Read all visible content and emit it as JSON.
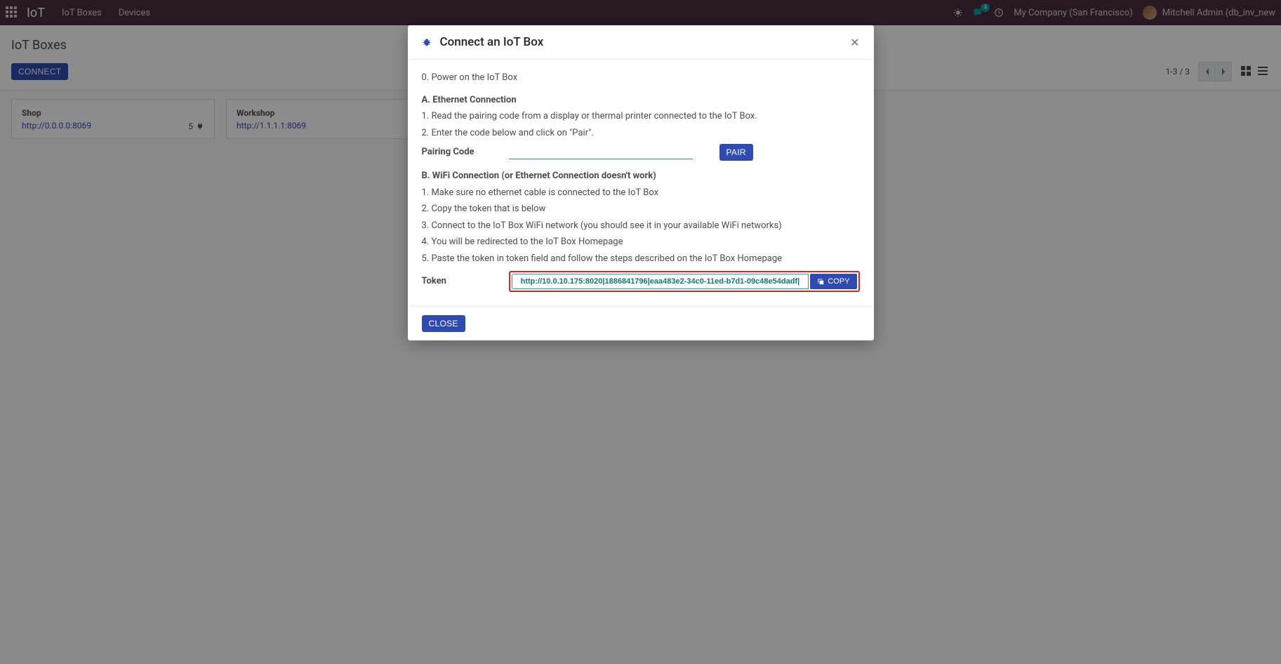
{
  "navbar": {
    "brand": "IoT",
    "links": [
      "IoT Boxes",
      "Devices"
    ],
    "messages_count": "4",
    "company": "My Company (San Francisco)",
    "user": "Mitchell Admin (db_inv_new"
  },
  "control_panel": {
    "breadcrumb": "IoT Boxes",
    "connect_label": "CONNECT",
    "pager": "1-3 / 3"
  },
  "cards": [
    {
      "title": "Shop",
      "url": "http://0.0.0.0:8069",
      "devices": "5"
    },
    {
      "title": "Workshop",
      "url": "http://1.1.1.1:8069",
      "devices": ""
    }
  ],
  "modal": {
    "title": "Connect an IoT Box",
    "step0": "0. Power on the IoT Box",
    "section_a_head": "A. Ethernet Connection",
    "section_a_1": "1. Read the pairing code from a display or thermal printer connected to the IoT Box.",
    "section_a_2": "2. Enter the code below and click on \"Pair\".",
    "pairing_code_label": "Pairing Code",
    "pair_btn": "PAIR",
    "section_b_head": "B. WiFi Connection (or Ethernet Connection doesn't work)",
    "section_b_1": "1. Make sure no ethernet cable is connected to the IoT Box",
    "section_b_2": "2. Copy the token that is below",
    "section_b_3": "3. Connect to the IoT Box WiFi network (you should see it in your available WiFi networks)",
    "section_b_4": "4. You will be redirected to the IoT Box Homepage",
    "section_b_5": "5. Paste the token in token field and follow the steps described on the IoT Box Homepage",
    "token_label": "Token",
    "token_value": "http://10.0.10.175:8020|1886841796|eaa483e2-34c0-11ed-b7d1-09c48e54dadf|",
    "copy_btn": "COPY",
    "close_btn": "CLOSE"
  }
}
